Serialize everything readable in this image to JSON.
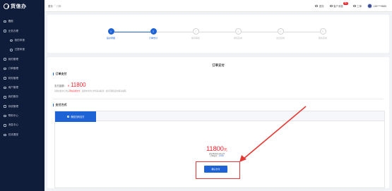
{
  "app": {
    "logo_text": "货信办"
  },
  "sidebar": {
    "items": [
      {
        "label": "首页",
        "sub": false
      },
      {
        "label": "业务办理",
        "sub": false
      },
      {
        "label": "我的申报",
        "sub": true
      },
      {
        "label": "已提申报",
        "sub": true
      },
      {
        "label": "我的管理",
        "sub": false
      },
      {
        "label": "订单管理",
        "sub": false
      },
      {
        "label": "财务管理",
        "sub": false
      },
      {
        "label": "用户管理",
        "sub": false
      },
      {
        "label": "我的服务",
        "sub": false
      },
      {
        "label": "系统管理",
        "sub": false
      },
      {
        "label": "帮助中心",
        "sub": false
      },
      {
        "label": "消息中心",
        "sub": false
      },
      {
        "label": "在线课堂",
        "sub": false
      }
    ]
  },
  "header": {
    "breadcrumb": [
      "首页",
      "/",
      "订单"
    ],
    "home_label": "首页",
    "msg_label": "客户消息",
    "msg_badge": "99+",
    "ticket_label": "工单",
    "user_label": "138****8888"
  },
  "steps": [
    {
      "label": "提交申报",
      "state": "done"
    },
    {
      "label": "订单支付",
      "state": "active"
    },
    {
      "label": "等待审核",
      "state": "pending"
    },
    {
      "label": "审核完成",
      "state": "pending"
    },
    {
      "label": "出证完成",
      "state": "pending"
    },
    {
      "label": "服务完成",
      "state": "pending"
    }
  ],
  "order": {
    "panel_title": "订单支付",
    "section_order": "订单支付",
    "amount_label": "支付金额：",
    "currency": "¥",
    "amount": "11800",
    "tip_prefix": "请您在提交订单后",
    "tip_red": "尽快完成支付",
    "tip_suffix": "，逾期未付款订单将自动取消，如有问题请及时联系客服。",
    "section_pay": "支付方式",
    "pay_tab_label": "微信扫码支付"
  },
  "payment": {
    "amount": "11800",
    "unit": "元",
    "sub_line1": "请使用微信扫码支付",
    "sub_line2_prefix": "订单编号：",
    "sub_line2_value": "17232",
    "confirm_label": "确认支付"
  }
}
